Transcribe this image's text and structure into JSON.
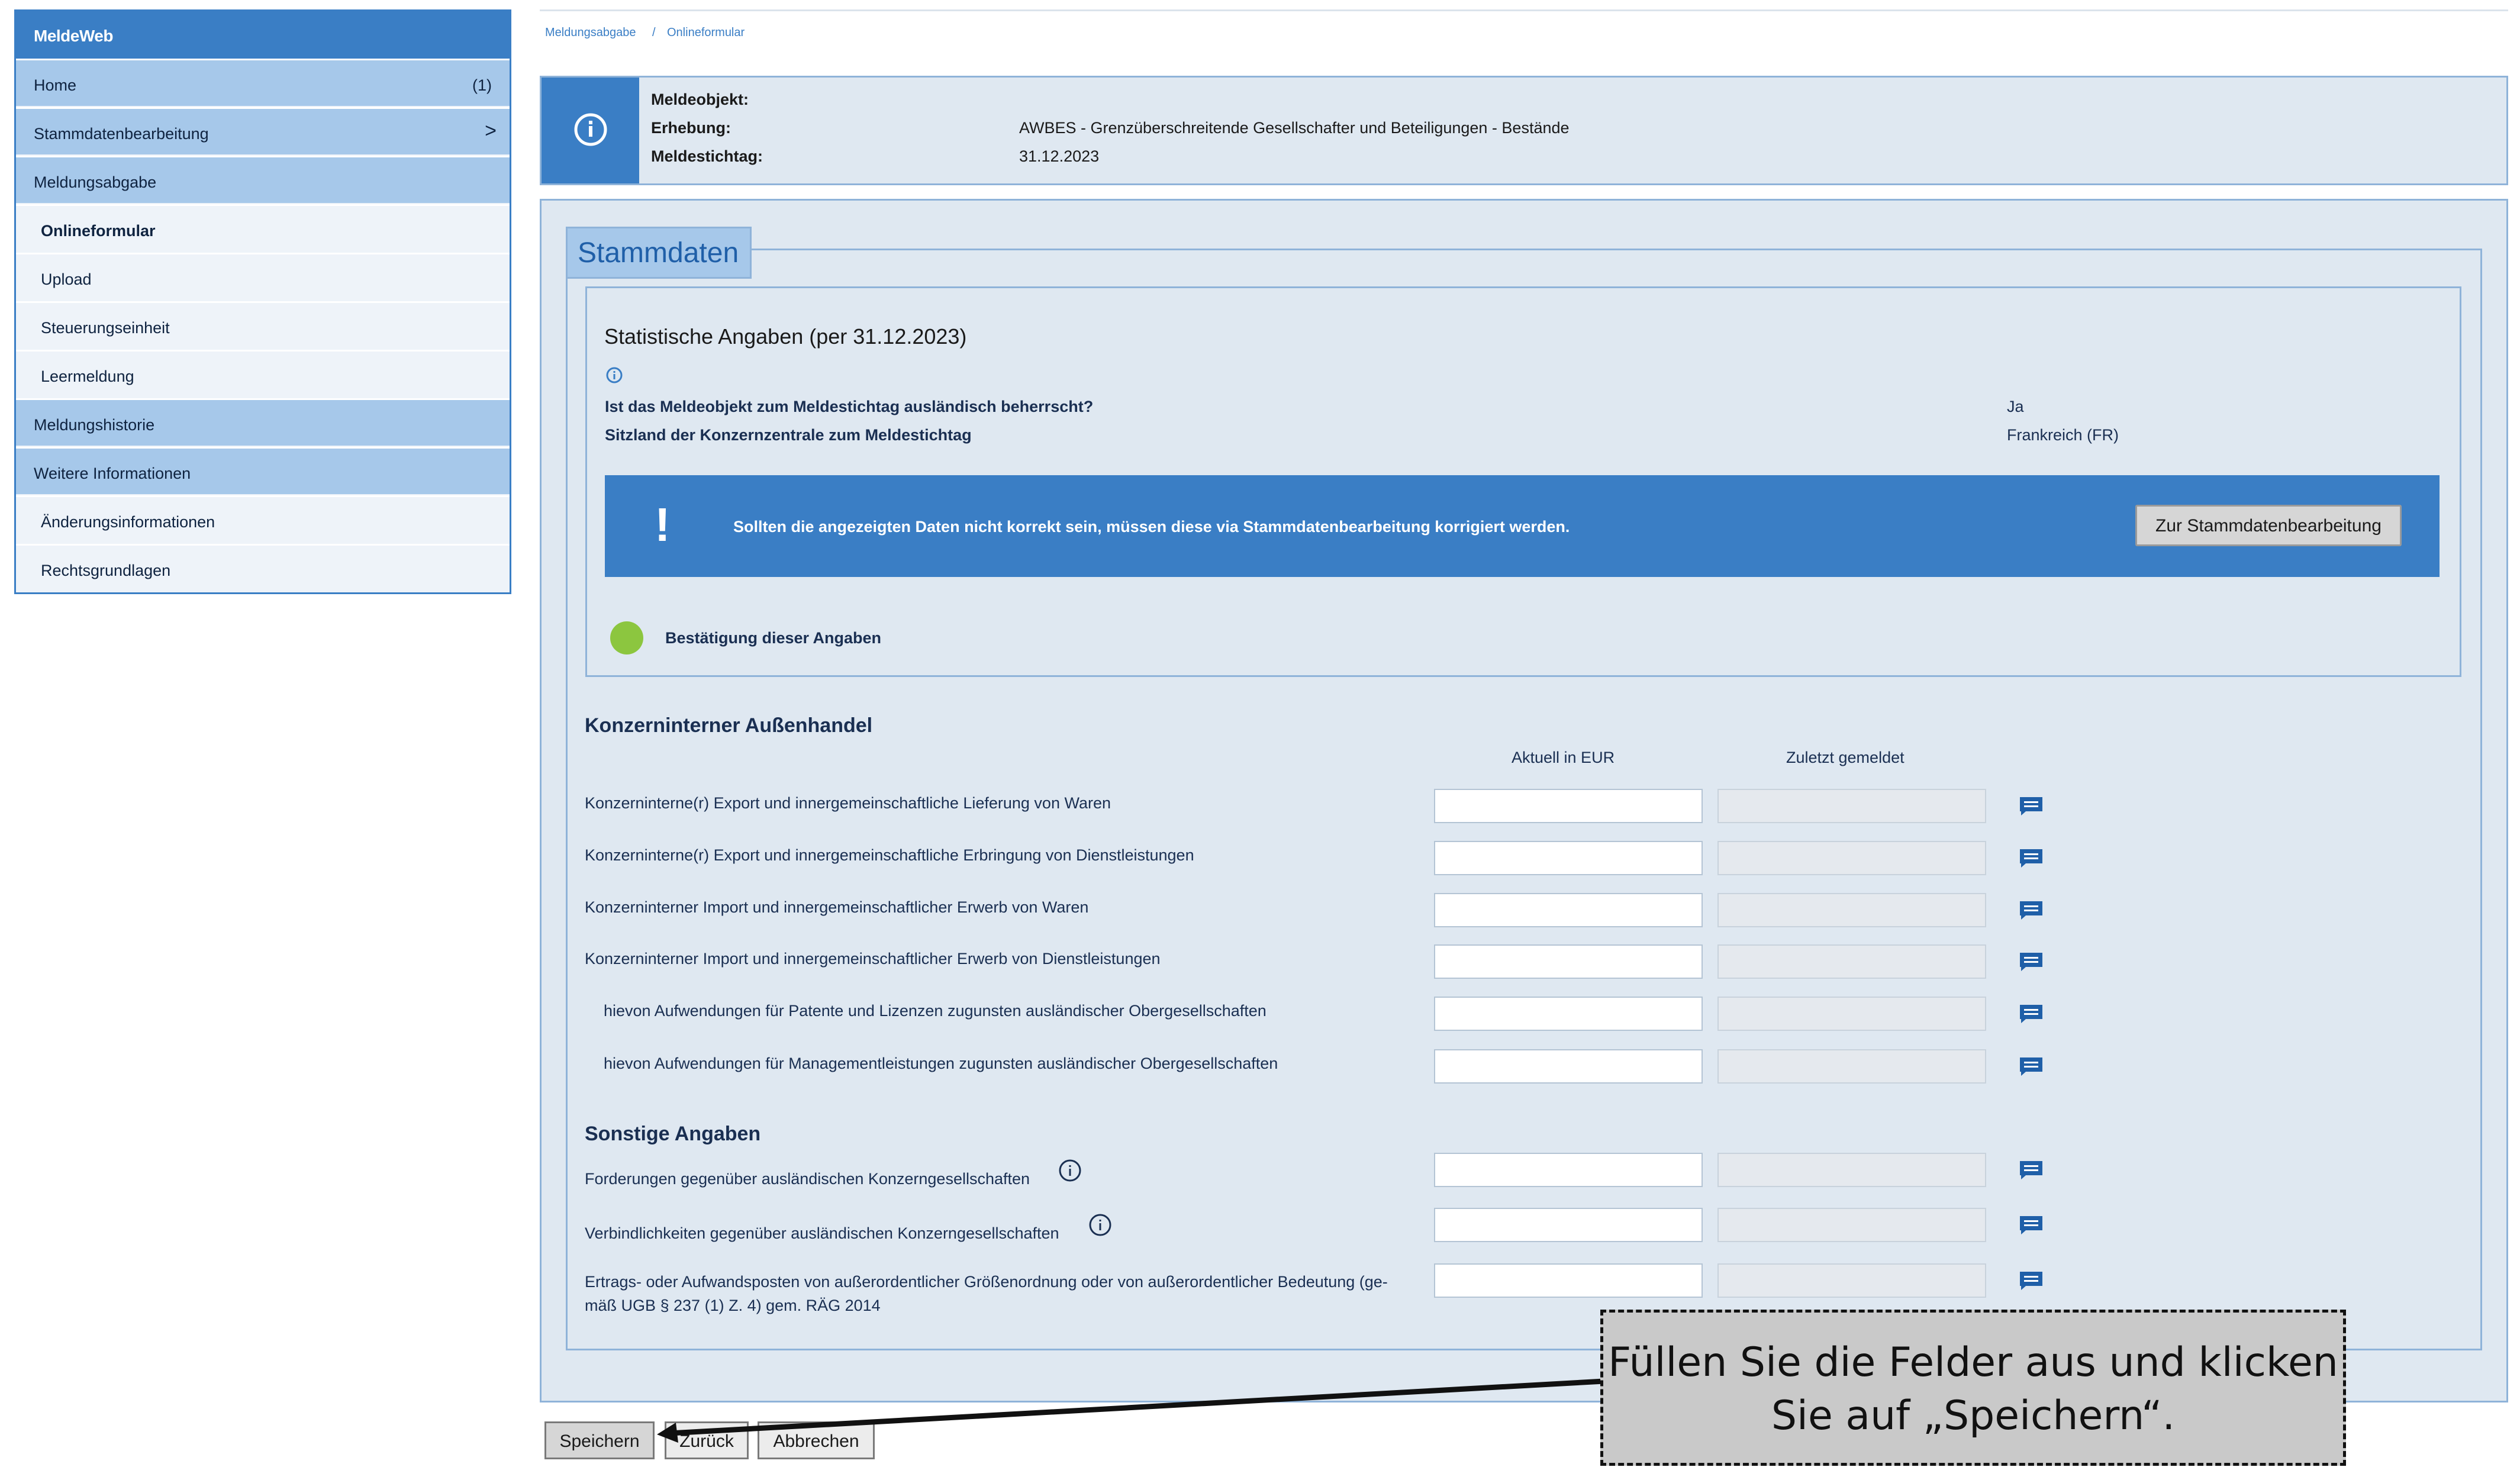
{
  "sidebar": {
    "title": "MeldeWeb",
    "items": [
      {
        "label": "Home",
        "count": "(1)"
      },
      {
        "label": "Stammdatenbearbeitung",
        "chevron": ">"
      },
      {
        "label": "Meldungsabgabe"
      },
      {
        "label": "Onlineformular"
      },
      {
        "label": "Upload"
      },
      {
        "label": "Steuerungseinheit"
      },
      {
        "label": "Leermeldung"
      },
      {
        "label": "Meldungshistorie"
      },
      {
        "label": "Weitere Informationen"
      },
      {
        "label": "Änderungsinformationen"
      },
      {
        "label": "Rechtsgrundlagen"
      }
    ]
  },
  "breadcrumb": {
    "item1": "Meldungsabgabe",
    "sep": "/",
    "item2": "Onlineformular"
  },
  "info": {
    "meldeobjekt_label": "Meldeobjekt:",
    "erhebung_label": "Erhebung:",
    "erhebung_value": "AWBES - Grenzüberschreitende Gesellschafter und Beteiligungen - Bestände",
    "stichtag_label": "Meldestichtag:",
    "stichtag_value": "31.12.2023"
  },
  "stammdaten": {
    "legend": "Stammdaten",
    "stat_title": "Statistische Angaben (per 31.12.2023)",
    "q1_label": "Ist das Meldeobjekt zum Meldestichtag ausländisch beherrscht?",
    "q1_value": "Ja",
    "q2_label": "Sitzland der Konzernzentrale zum Meldestichtag",
    "q2_value": "Frankreich (FR)",
    "warning_text": "Sollten die angezeigten Daten nicht korrekt sein, müssen diese via Stammdatenbearbeitung korrigiert werden.",
    "warning_button": "Zur Stammdatenbearbeitung",
    "confirm_label": "Bestätigung dieser Angaben"
  },
  "colors": {
    "accent": "#3a7ec5",
    "light": "#a6c8ea",
    "panel": "#dfe8f1",
    "confirm": "#8cc63f"
  },
  "aussenhandel": {
    "heading": "Konzerninterner Außenhandel",
    "col_current": "Aktuell in EUR",
    "col_last": "Zuletzt gemeldet",
    "rows": [
      {
        "label": "Konzerninterne(r) Export und innergemeinschaftliche Lieferung von Waren",
        "value": ""
      },
      {
        "label": "Konzerninterne(r) Export und innergemeinschaftliche Erbringung von Dienstleistungen",
        "value": ""
      },
      {
        "label": "Konzerninterner Import und innergemeinschaftlicher Erwerb von Waren",
        "value": ""
      },
      {
        "label": "Konzerninterner Import und innergemeinschaftlicher Erwerb von Dienstleistungen",
        "value": ""
      },
      {
        "label": "hievon Aufwendungen für Patente und Lizenzen zugunsten ausländischer Obergesellschaften",
        "value": ""
      },
      {
        "label": "hievon Aufwendungen für Managementleistungen zugunsten ausländischer Obergesellschaften",
        "value": ""
      }
    ]
  },
  "sonstige": {
    "heading": "Sonstige Angaben",
    "rows": [
      {
        "label": "Forderungen gegenüber ausländischen Konzerngesellschaften",
        "value": ""
      },
      {
        "label": "Verbindlichkeiten gegenüber ausländischen Konzerngesellschaften",
        "value": ""
      },
      {
        "label_line1": "Ertrags- oder Aufwandsposten von außerordentlicher Größenordnung oder von außerordentlicher Bedeutung (ge-",
        "label_line2": "mäß UGB § 237 (1) Z. 4) gem. RÄG 2014",
        "value": ""
      }
    ]
  },
  "buttons": {
    "save": "Speichern",
    "back": "Zurück",
    "cancel": "Abbrechen"
  },
  "callout": {
    "line1": "Füllen Sie die Felder aus und klicken",
    "line2": "Sie auf „Speichern“."
  }
}
